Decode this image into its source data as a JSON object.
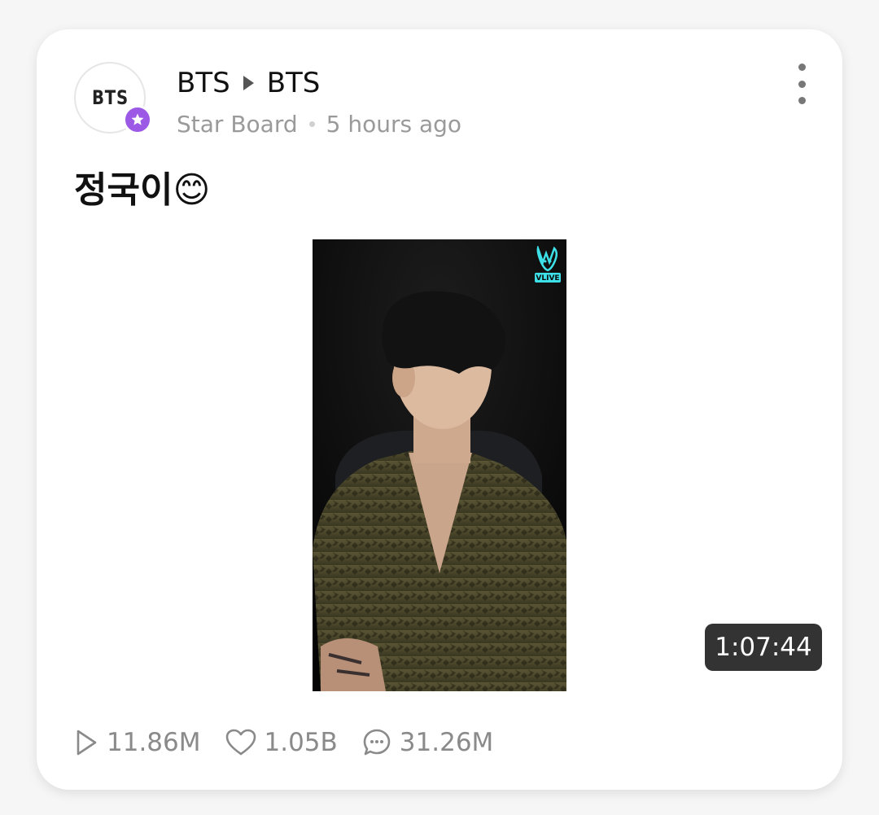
{
  "post": {
    "author_logo": "BTS",
    "channel_from": "BTS",
    "channel_to": "BTS",
    "board": "Star Board",
    "time_ago": "5 hours ago",
    "text": "정국이😊"
  },
  "video": {
    "duration": "1:07:44",
    "badge": "VLIVE"
  },
  "stats": {
    "plays": "11.86M",
    "likes": "1.05B",
    "comments": "31.26M"
  },
  "icons": {
    "header_arrow": "triangle-right-icon",
    "verified": "star-badge-icon",
    "more": "more-vertical-icon",
    "plays": "play-icon",
    "likes": "heart-icon",
    "comments": "comment-icon",
    "video_badge": "vlive-logo-icon"
  },
  "colors": {
    "badge_purple": "#9b59e6",
    "duration_bg": "#333333",
    "vlive_cyan": "#3ee0e8"
  }
}
